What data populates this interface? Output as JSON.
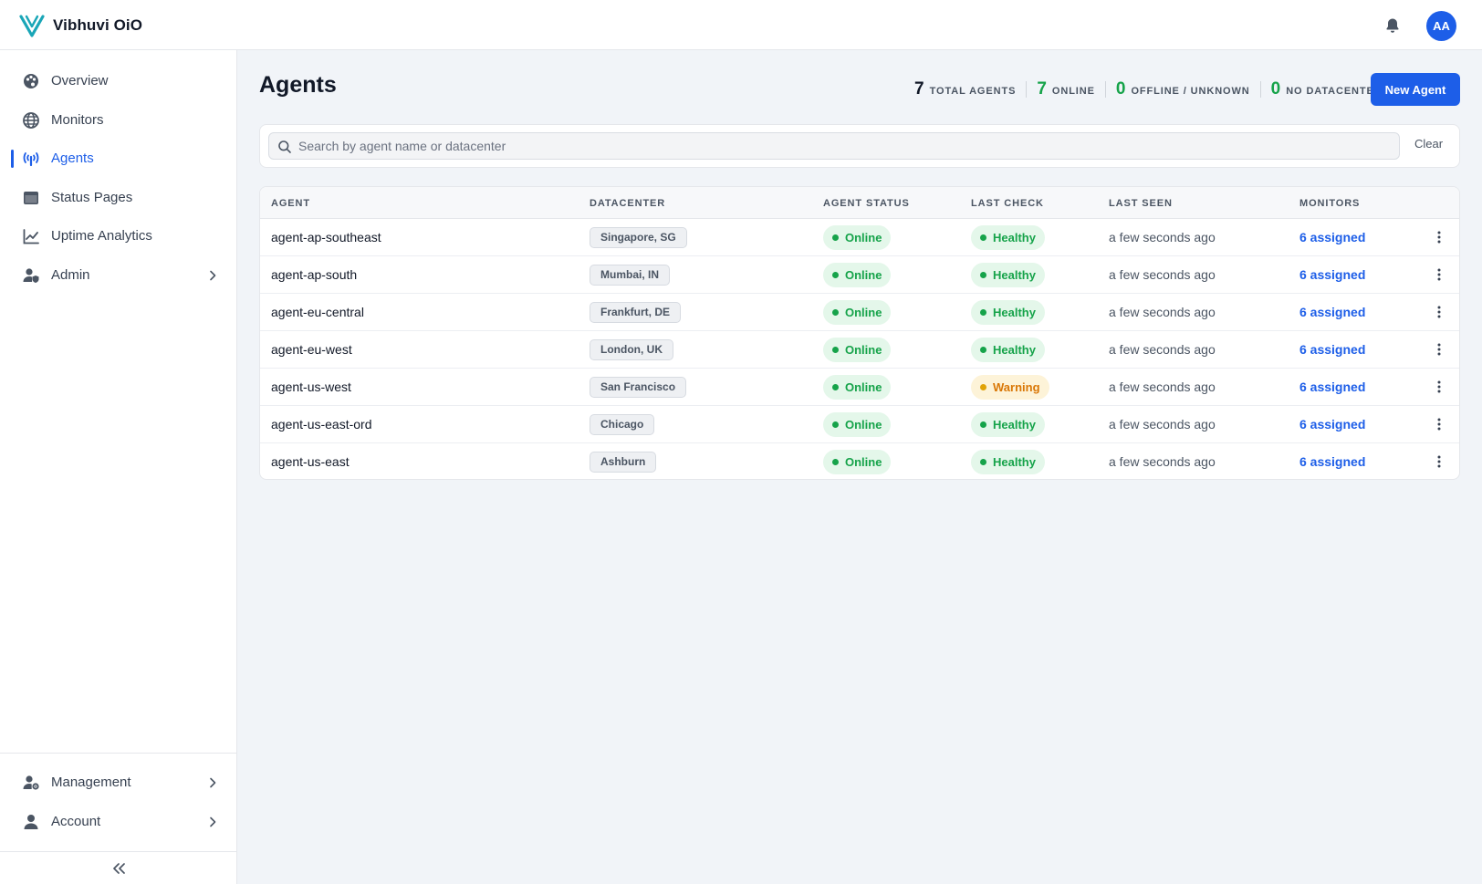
{
  "app": {
    "name": "Vibhuvi OiO",
    "user_initials": "AA"
  },
  "colors": {
    "accent": "#1d5ee8",
    "online": "#16a34a",
    "warning": "#d97706"
  },
  "sidebar": {
    "items": [
      {
        "label": "Overview",
        "icon": "palette-icon"
      },
      {
        "label": "Monitors",
        "icon": "globe-icon"
      },
      {
        "label": "Agents",
        "icon": "antenna-icon",
        "active": true
      },
      {
        "label": "Status Pages",
        "icon": "window-icon"
      },
      {
        "label": "Uptime Analytics",
        "icon": "chart-line-icon"
      },
      {
        "label": "Admin",
        "icon": "user-shield-icon",
        "expandable": true
      }
    ],
    "bottom_items": [
      {
        "label": "Management",
        "icon": "user-gear-icon",
        "expandable": true
      },
      {
        "label": "Account",
        "icon": "user-icon",
        "expandable": true
      }
    ]
  },
  "page": {
    "title": "Agents",
    "new_button": "New Agent"
  },
  "stats": [
    {
      "value": "7",
      "label": "TOTAL AGENTS",
      "color": "#111827"
    },
    {
      "value": "7",
      "label": "ONLINE",
      "color": "#16a34a"
    },
    {
      "value": "0",
      "label": "OFFLINE / UNKNOWN",
      "color": "#16a34a"
    },
    {
      "value": "0",
      "label": "NO DATACENTER",
      "color": "#16a34a"
    }
  ],
  "search": {
    "placeholder": "Search by agent name or datacenter",
    "value": "",
    "clear_label": "Clear"
  },
  "table": {
    "columns": [
      "AGENT",
      "DATACENTER",
      "AGENT STATUS",
      "LAST CHECK",
      "LAST SEEN",
      "MONITORS"
    ],
    "rows": [
      {
        "agent": "agent-ap-southeast",
        "datacenter": "Singapore, SG",
        "status": "Online",
        "check": "Healthy",
        "check_level": "green",
        "last_seen": "a few seconds ago",
        "monitors": "6 assigned"
      },
      {
        "agent": "agent-ap-south",
        "datacenter": "Mumbai, IN",
        "status": "Online",
        "check": "Healthy",
        "check_level": "green",
        "last_seen": "a few seconds ago",
        "monitors": "6 assigned"
      },
      {
        "agent": "agent-eu-central",
        "datacenter": "Frankfurt, DE",
        "status": "Online",
        "check": "Healthy",
        "check_level": "green",
        "last_seen": "a few seconds ago",
        "monitors": "6 assigned"
      },
      {
        "agent": "agent-eu-west",
        "datacenter": "London, UK",
        "status": "Online",
        "check": "Healthy",
        "check_level": "green",
        "last_seen": "a few seconds ago",
        "monitors": "6 assigned"
      },
      {
        "agent": "agent-us-west",
        "datacenter": "San Francisco",
        "status": "Online",
        "check": "Warning",
        "check_level": "amber",
        "last_seen": "a few seconds ago",
        "monitors": "6 assigned"
      },
      {
        "agent": "agent-us-east-ord",
        "datacenter": "Chicago",
        "status": "Online",
        "check": "Healthy",
        "check_level": "green",
        "last_seen": "a few seconds ago",
        "monitors": "6 assigned"
      },
      {
        "agent": "agent-us-east",
        "datacenter": "Ashburn",
        "status": "Online",
        "check": "Healthy",
        "check_level": "green",
        "last_seen": "a few seconds ago",
        "monitors": "6 assigned"
      }
    ]
  }
}
